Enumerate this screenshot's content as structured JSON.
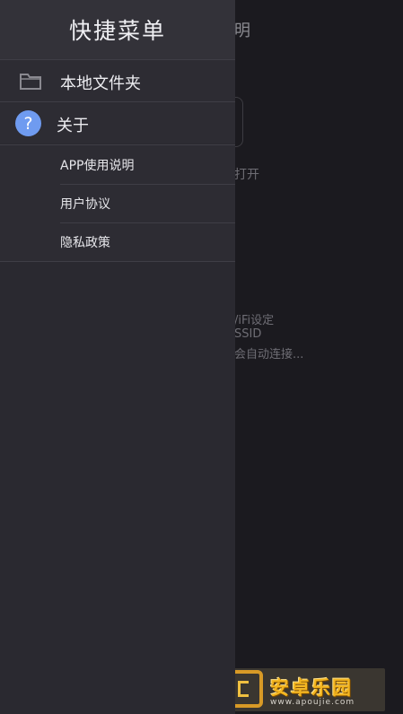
{
  "background": {
    "title_fragment": "明",
    "open_fragment": "打开",
    "lines": [
      "/iFi设定",
      "SSID",
      "会自动连接..."
    ]
  },
  "drawer": {
    "title": "快捷菜单",
    "items": [
      {
        "label": "本地文件夹",
        "icon": "folder-icon"
      },
      {
        "label": "关于",
        "icon": "help-icon"
      }
    ],
    "help_glyph": "?",
    "sub_items": [
      {
        "label": "APP使用说明"
      },
      {
        "label": "用户协议"
      },
      {
        "label": "隐私政策"
      }
    ]
  },
  "watermark": {
    "text": "安卓乐园",
    "url": "www.apoujie.com"
  },
  "colors": {
    "drawer_bg": "#2a2930",
    "header_bg": "#333239",
    "help_icon": "#6f9bf0",
    "watermark_gold": "#f3b51f"
  }
}
